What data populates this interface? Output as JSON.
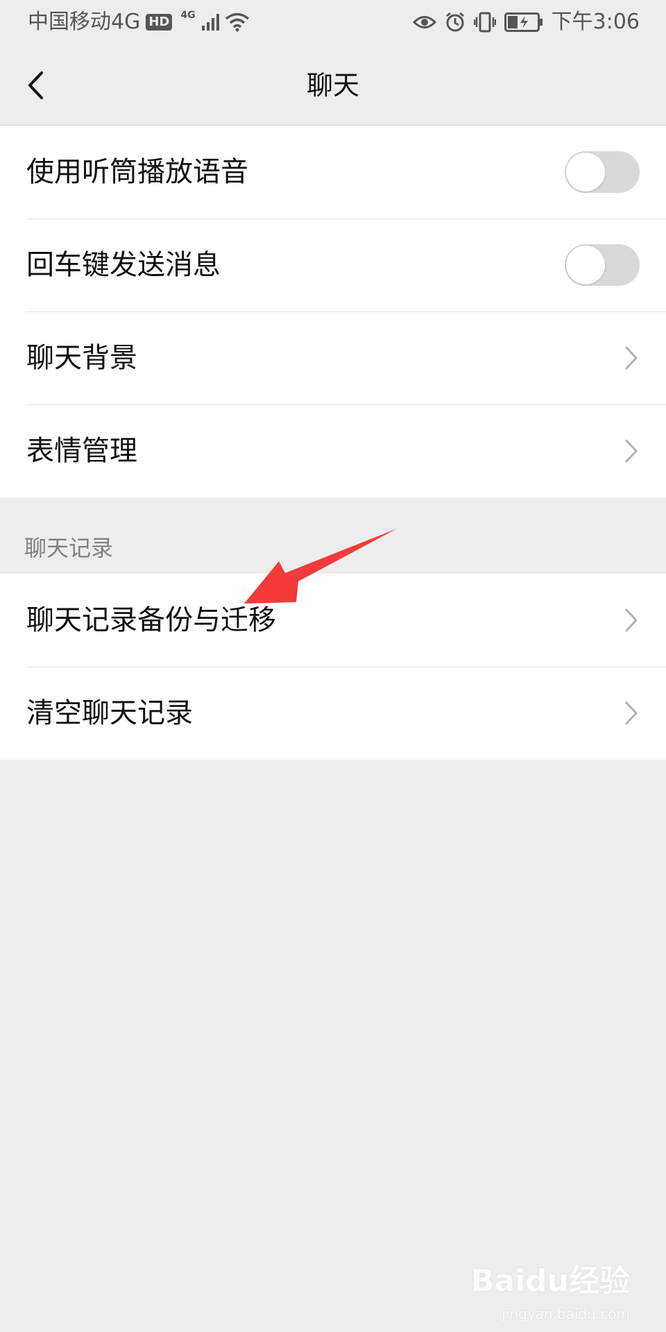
{
  "status_bar": {
    "carrier": "中国移动4G",
    "hd_badge": "HD",
    "signal_type": "4G",
    "time": "下午3:06",
    "icons": [
      "hd-icon",
      "signal-icon",
      "wifi-icon",
      "eye-icon",
      "alarm-icon",
      "vibrate-icon",
      "battery-icon"
    ]
  },
  "nav": {
    "title": "聊天",
    "back_icon": "chevron-left-icon"
  },
  "settings": {
    "group1": [
      {
        "label": "使用听筒播放语音",
        "type": "toggle",
        "on": false
      },
      {
        "label": "回车键发送消息",
        "type": "toggle",
        "on": false
      },
      {
        "label": "聊天背景",
        "type": "link"
      },
      {
        "label": "表情管理",
        "type": "link"
      }
    ],
    "section_header": "聊天记录",
    "group2": [
      {
        "label": "聊天记录备份与迁移",
        "type": "link"
      },
      {
        "label": "清空聊天记录",
        "type": "link"
      }
    ]
  },
  "annotation": {
    "arrow_color": "#f43a3a"
  },
  "watermark": {
    "brand": "Baidu经验",
    "url": "jingyan.baidu.com"
  },
  "colors": {
    "background": "#ededed",
    "card": "#ffffff",
    "toggle_off": "#d9d9d9"
  }
}
